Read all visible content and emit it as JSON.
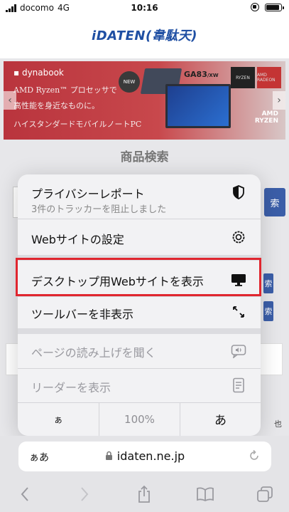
{
  "status_bar": {
    "carrier": "docomo",
    "network": "4G",
    "time": "10:16",
    "battery_level": 0.9
  },
  "site": {
    "logo": "iDATEN(韋駄天)"
  },
  "banner": {
    "brand": "dynabook",
    "badge": "NEW",
    "model": "GA83",
    "model_suffix": "/XW",
    "line1": "AMD Ryzen™ プロセッサで",
    "line2": "高性能を身近なものに。",
    "line3": "ハイスタンダードモバイルノートPC",
    "chip1": "RYZEN",
    "chip2": "AMD RADEON",
    "amd": "AMD",
    "amd_sub": "RYZEN"
  },
  "page": {
    "section_title": "商品検索",
    "search_button": "索",
    "side1": "索",
    "side2": "索",
    "side_text": "也"
  },
  "menu": {
    "privacy_label": "プライバシーレポート",
    "privacy_sub": "3件のトラッカーを阻止しました",
    "website_settings": "Webサイトの設定",
    "desktop_site": "デスクトップ用Webサイトを表示",
    "hide_toolbar": "ツールバーを非表示",
    "listen_page": "ページの読み上げを聞く",
    "show_reader": "リーダーを表示",
    "text_smaller": "ぁ",
    "zoom": "100%",
    "text_larger": "あ"
  },
  "address_bar": {
    "aa": "ぁあ",
    "url": "idaten.ne.jp"
  },
  "icons": {
    "privacy": "shield-icon",
    "settings": "gear-icon",
    "desktop": "monitor-icon",
    "hide_toolbar": "expand-arrows-icon",
    "listen": "speech-bubble-icon",
    "reader": "document-icon",
    "lock": "lock-icon",
    "reload": "reload-icon",
    "back": "chevron-left-icon",
    "forward": "chevron-right-icon",
    "share": "share-icon",
    "bookmarks": "book-icon",
    "tabs": "tabs-icon"
  },
  "colors": {
    "highlight": "#e0262f",
    "logo": "#1f4fa3",
    "banner": "#b9343d",
    "button": "#3b5ea8"
  }
}
